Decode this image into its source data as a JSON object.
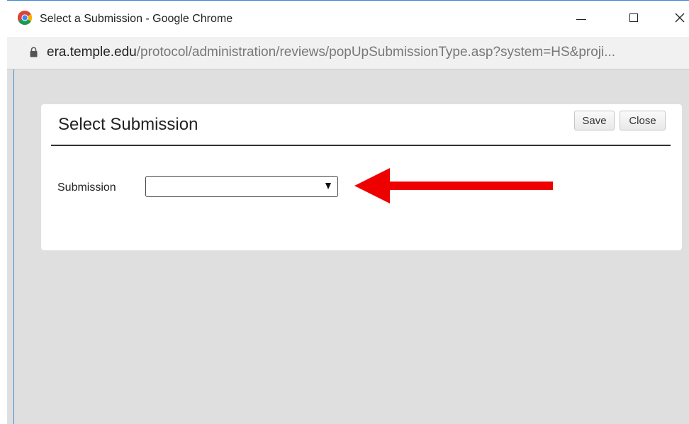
{
  "window": {
    "title": "Select a Submission - Google Chrome"
  },
  "address": {
    "domain": "era.temple.edu",
    "path": "/protocol/administration/reviews/popUpSubmissionType.asp?system=HS&proji..."
  },
  "dialog": {
    "title": "Select Submission",
    "save_label": "Save",
    "close_label": "Close",
    "field_label": "Submission",
    "select_value": ""
  },
  "colors": {
    "arrow": "#ee0000",
    "window_border": "#3c88d6",
    "content_bg": "#dfdfdf"
  },
  "icons": {
    "browser": "chrome-logo-icon",
    "lock": "lock-icon",
    "minimize": "minimize-icon",
    "maximize": "maximize-icon",
    "close": "close-icon",
    "dropdown": "dropdown-arrow-icon",
    "annotation": "red-arrow-annotation"
  }
}
